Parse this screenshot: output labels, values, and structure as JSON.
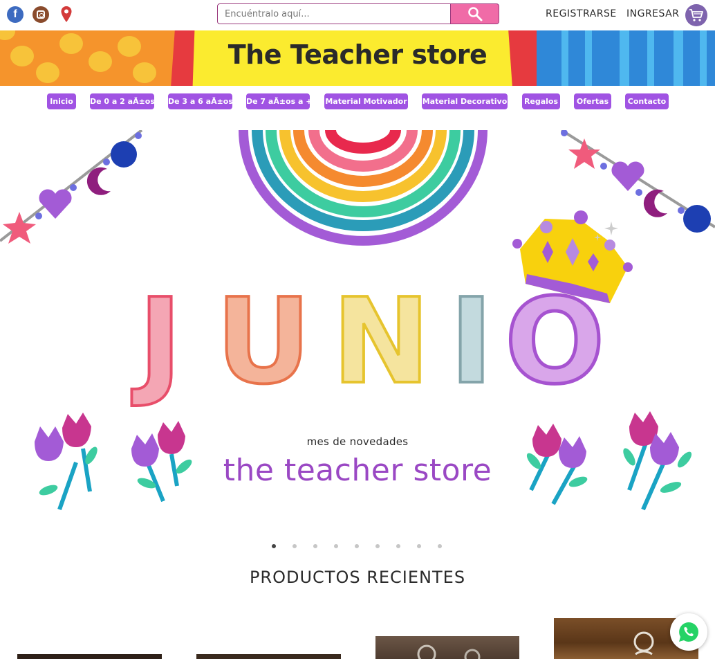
{
  "topbar": {
    "social": [
      {
        "icon": "facebook-icon",
        "glyph": "f",
        "color": "#3d6bc0"
      },
      {
        "icon": "instagram-icon",
        "color": "#8a4b2c"
      },
      {
        "icon": "location-pin-icon",
        "color": "#d33a3a"
      }
    ],
    "search": {
      "placeholder": "Encuéntralo aquí...",
      "value": ""
    },
    "register_label": "REGISTRARSE",
    "login_label": "INGRESAR",
    "cart_icon": "cart-icon"
  },
  "banner": {
    "title": "The Teacher store"
  },
  "nav": {
    "items": [
      {
        "label": "Inicio"
      },
      {
        "label": "De 0 a 2 aÃ±os"
      },
      {
        "label": "De 3 a 6 aÃ±os"
      },
      {
        "label": "De 7 aÃ±os a +"
      },
      {
        "label": "Material Motivador"
      },
      {
        "label": "Material Decorativo"
      },
      {
        "label": "Regalos"
      },
      {
        "label": "Ofertas"
      },
      {
        "label": "Contacto"
      }
    ],
    "color": "#a053e3"
  },
  "hero": {
    "letters": [
      "J",
      "U",
      "N",
      "I",
      "O"
    ],
    "subtitle": "mes de novedades",
    "brand": "the teacher store",
    "slide_count": 9,
    "active_slide": 1
  },
  "products": {
    "title": "PRODUCTOS RECIENTES"
  },
  "colors": {
    "accent_pink": "#f06ba7",
    "accent_purple": "#a053e3",
    "brand_purple": "#9a48c4"
  },
  "whatsapp_icon": "whatsapp-icon"
}
